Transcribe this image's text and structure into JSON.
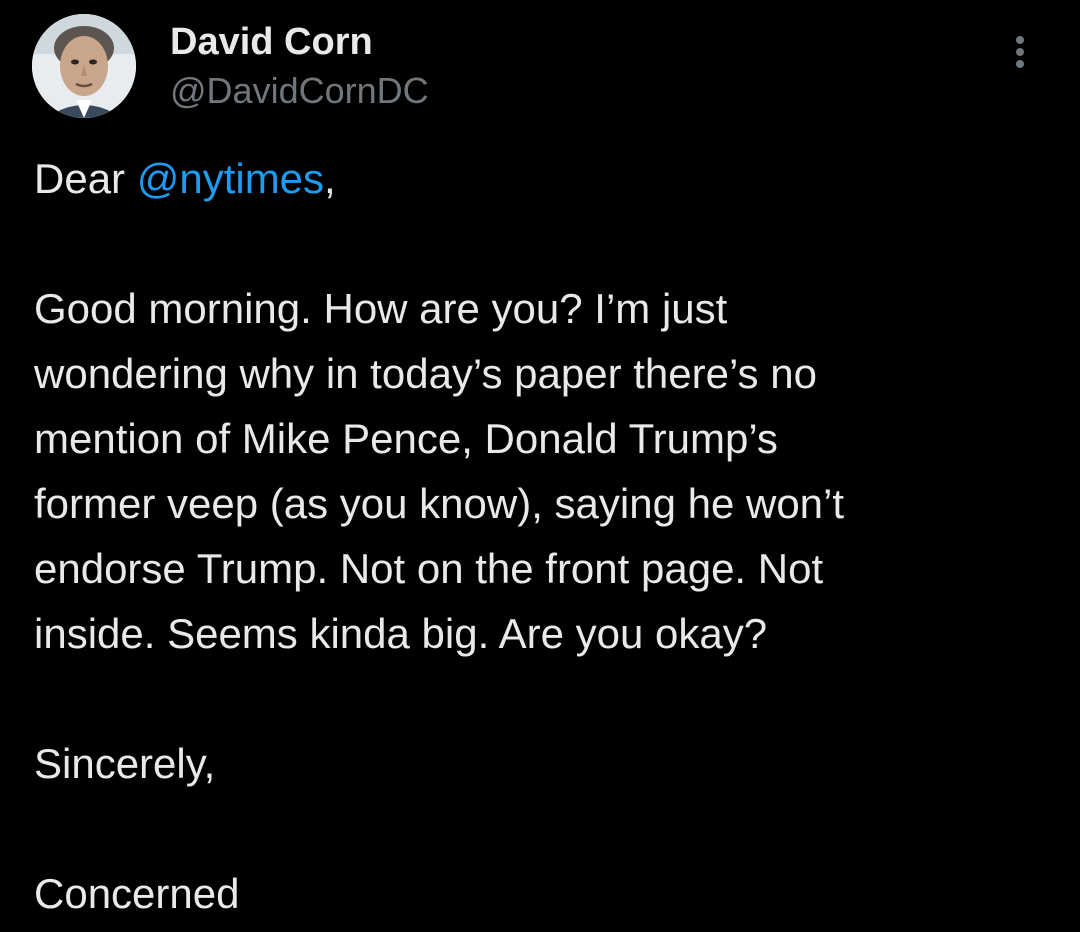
{
  "author": {
    "display_name": "David Corn",
    "handle": "@DavidCornDC",
    "avatar_icon": "profile-photo"
  },
  "menu": {
    "icon": "more-vertical-icon"
  },
  "tweet": {
    "greeting_prefix": "Dear ",
    "mention": "@nytimes",
    "greeting_suffix": ",",
    "lines": [
      "Good morning. How are you? I’m just",
      "wondering why in today’s paper there’s no",
      "mention of Mike Pence, Donald Trump’s",
      "former veep (as you know), saying he won’t",
      "endorse Trump. Not on the front page. Not",
      "inside. Seems kinda big. Are you okay?"
    ],
    "closing": "Sincerely,",
    "signature": "Concerned"
  },
  "colors": {
    "background": "#000000",
    "text": "#e7e9ea",
    "secondary": "#71767b",
    "link": "#1d9bf0"
  }
}
